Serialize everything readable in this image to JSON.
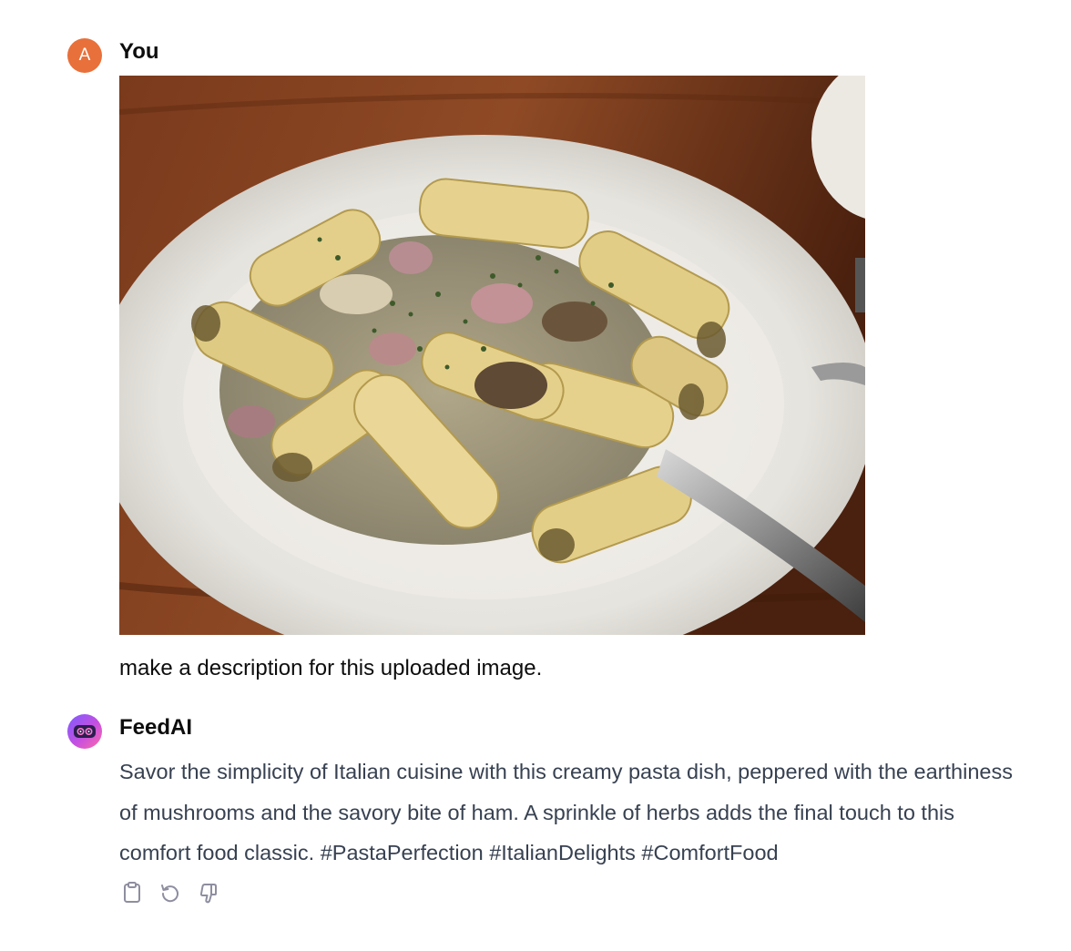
{
  "user_message": {
    "avatar_letter": "A",
    "author": "You",
    "image_subject": "plate of rigatoni pasta with mushrooms and ham on a white plate, tongs on the side",
    "text": "make a description for this uploaded image."
  },
  "assistant_message": {
    "author": "FeedAI",
    "text": "Savor the simplicity of Italian cuisine with this creamy pasta dish, peppered with the earthiness of mushrooms and the savory bite of ham. A sprinkle of herbs adds the final touch to this comfort food classic. #PastaPerfection #ItalianDelights #ComfortFood",
    "actions": [
      {
        "name": "copy",
        "icon": "clipboard-icon"
      },
      {
        "name": "regenerate",
        "icon": "refresh-icon"
      },
      {
        "name": "bad-response",
        "icon": "thumbs-down-icon"
      }
    ]
  },
  "colors": {
    "user_avatar": "#e8703a",
    "assistant_text": "#374151",
    "icon_gray": "#8e8ea0"
  }
}
